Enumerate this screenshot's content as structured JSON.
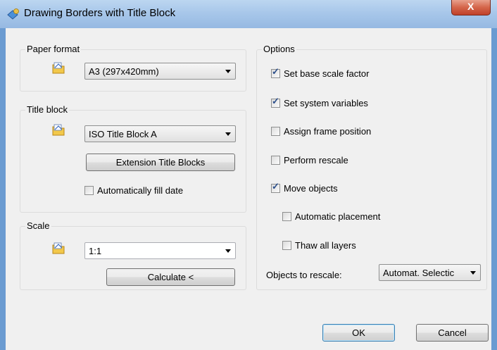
{
  "window": {
    "title": "Drawing Borders with Title Block",
    "close_label": "X"
  },
  "paper_format": {
    "label": "Paper format",
    "value": "A3 (297x420mm)"
  },
  "title_block": {
    "label": "Title block",
    "value": "ISO Title Block A",
    "extension_button": "Extension Title Blocks",
    "auto_fill_date": {
      "label": "Automatically fill date",
      "checked": false
    }
  },
  "scale": {
    "label": "Scale",
    "value": "1:1",
    "calculate_button": "Calculate <"
  },
  "options": {
    "label": "Options",
    "set_base_scale_factor": {
      "label": "Set base scale factor",
      "checked": true
    },
    "set_system_variables": {
      "label": "Set system variables",
      "checked": true
    },
    "assign_frame_position": {
      "label": "Assign frame position",
      "checked": false
    },
    "perform_rescale": {
      "label": "Perform rescale",
      "checked": false
    },
    "move_objects": {
      "label": "Move objects",
      "checked": true
    },
    "automatic_placement": {
      "label": "Automatic placement",
      "checked": false
    },
    "thaw_all_layers": {
      "label": "Thaw all layers",
      "checked": false
    },
    "objects_to_rescale_label": "Objects to rescale:",
    "objects_to_rescale_value": "Automat. Selectic"
  },
  "footer": {
    "ok": "OK",
    "cancel": "Cancel"
  },
  "icons": {
    "title": "dialog-app-icon",
    "folder": "folder-icon"
  },
  "colors": {
    "titlebar": "#a8c7ea",
    "close": "#c0412a",
    "face": "#f0f0f0",
    "check": "#2c4f8a"
  }
}
